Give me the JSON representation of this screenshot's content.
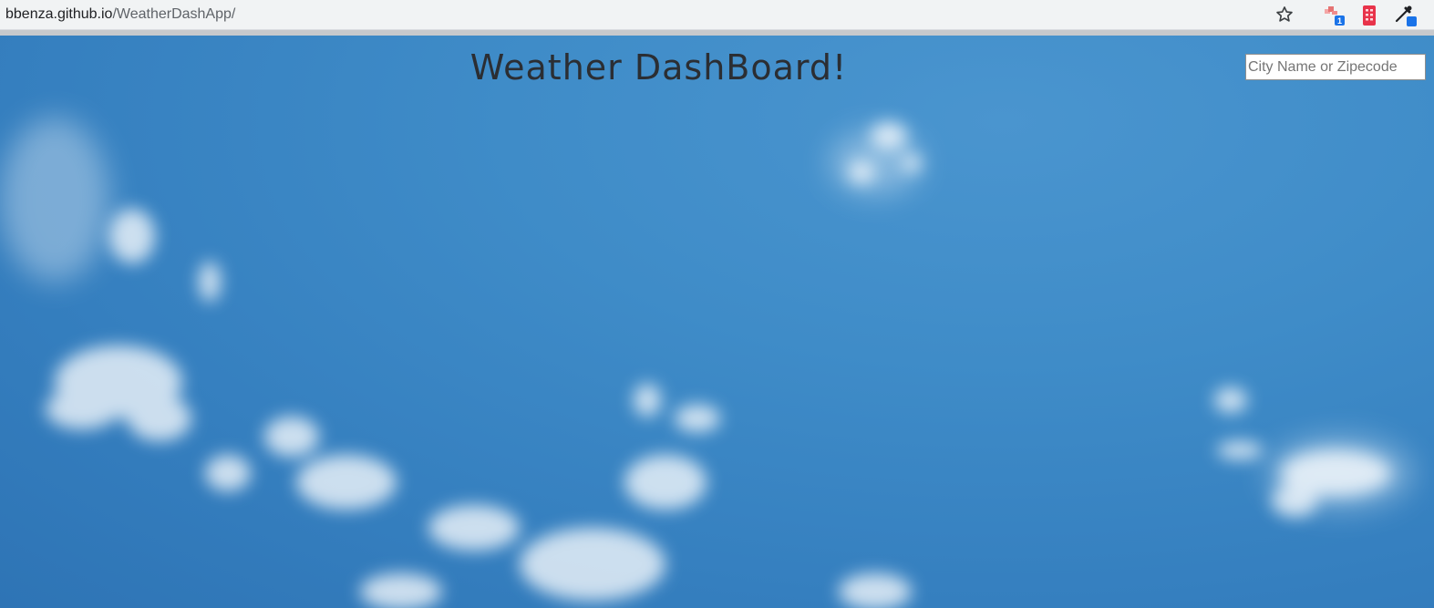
{
  "browser": {
    "url_domain": "bbenza.github.io",
    "url_path": "/WeatherDashApp/",
    "extension_badge_count": "1"
  },
  "icons": {
    "bookmark": "star-icon",
    "extension_1": "extension-icon",
    "extension_2": "building-icon",
    "extension_3": "eyedropper-icon"
  },
  "page": {
    "title": "Weather DashBoard!",
    "search": {
      "placeholder": "City Name or Zipecode",
      "value": ""
    }
  },
  "colors": {
    "sky": "#3a87c5",
    "title_text": "#2b2e33",
    "browser_bar": "#f1f3f4"
  }
}
